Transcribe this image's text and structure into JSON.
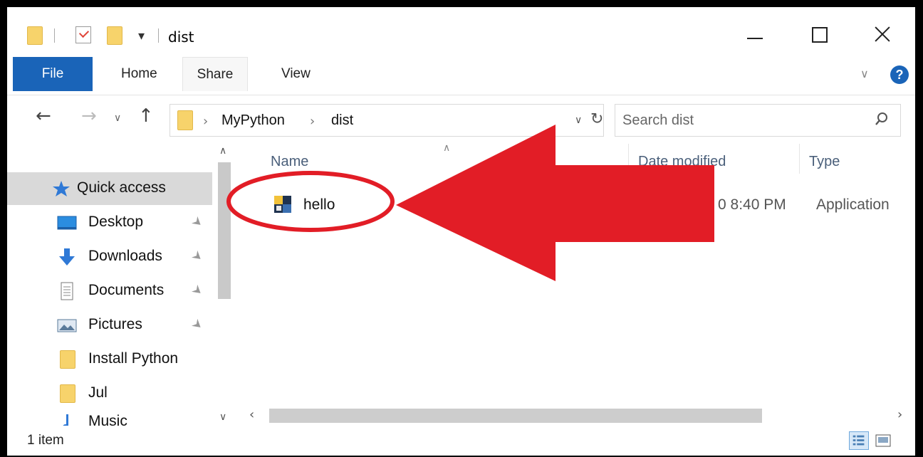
{
  "window": {
    "title": "dist"
  },
  "ribbon": {
    "tabs": [
      "File",
      "Home",
      "Share",
      "View"
    ],
    "help": "?"
  },
  "address": {
    "crumbs": [
      "MyPython",
      "dist"
    ]
  },
  "search": {
    "placeholder": "Search dist"
  },
  "nav_pane": {
    "items": [
      {
        "label": "Quick access",
        "icon": "star-icon",
        "selected": true
      },
      {
        "label": "Desktop",
        "icon": "desktop-icon",
        "pinned": true
      },
      {
        "label": "Downloads",
        "icon": "download-arrow-icon",
        "pinned": true
      },
      {
        "label": "Documents",
        "icon": "document-icon",
        "pinned": true
      },
      {
        "label": "Pictures",
        "icon": "pictures-icon",
        "pinned": true
      },
      {
        "label": "Install Python",
        "icon": "folder-icon"
      },
      {
        "label": "Jul",
        "icon": "folder-icon"
      },
      {
        "label": "Music",
        "icon": "music-icon"
      }
    ]
  },
  "columns": {
    "name": "Name",
    "date": "Date modified",
    "type": "Type"
  },
  "files": [
    {
      "name": "hello",
      "date_visible": "0 8:40 PM",
      "type": "Application",
      "icon": "application-icon"
    }
  ],
  "status": {
    "count": "1 item"
  },
  "colors": {
    "accent": "#1a64b8",
    "folder": "#f7d36b",
    "annotation": "#e21d26"
  }
}
